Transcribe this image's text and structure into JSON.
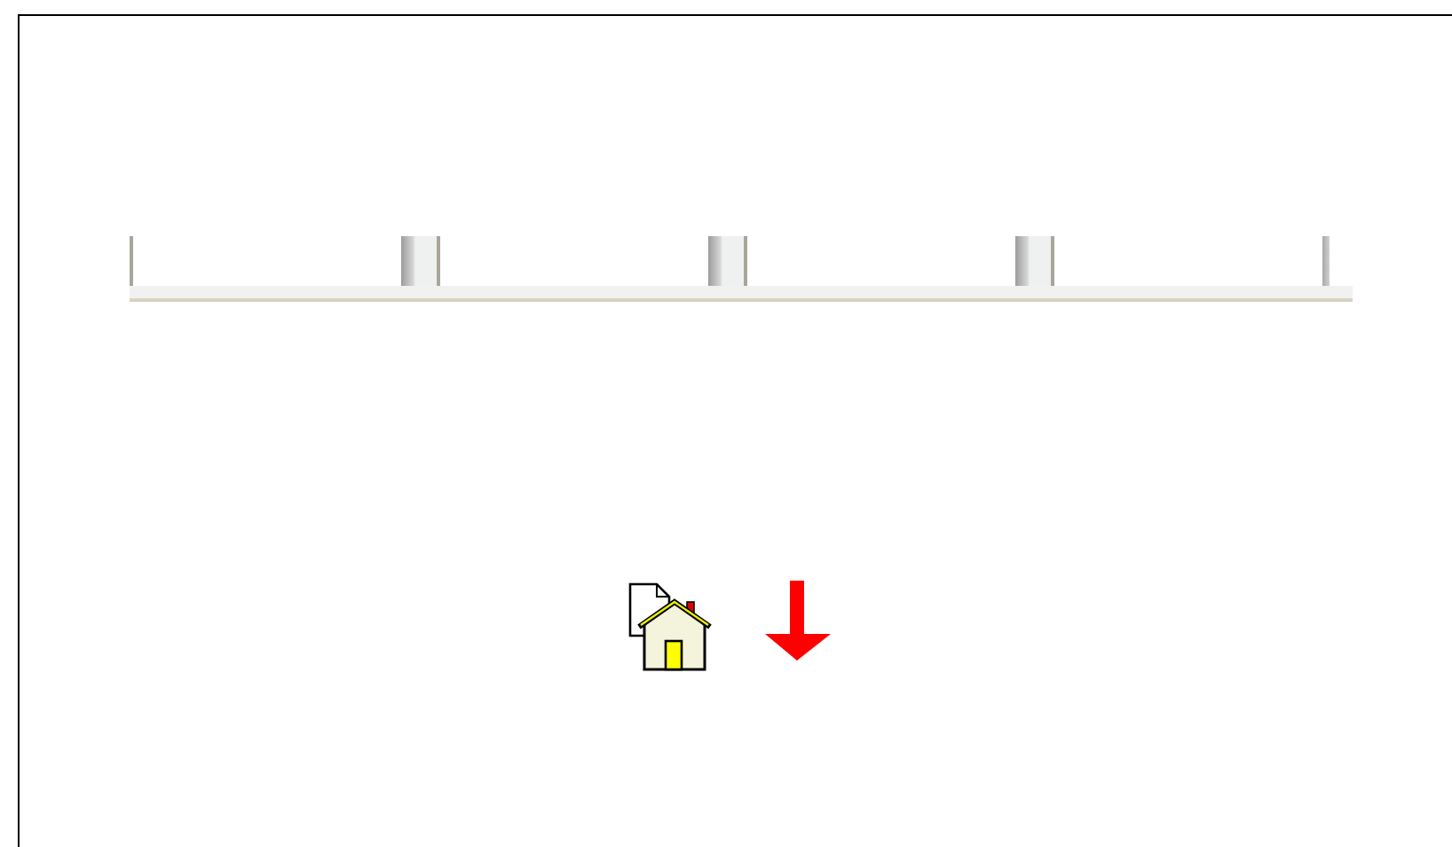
{
  "tabs": [
    {
      "kind": "blank"
    },
    {
      "kind": "blank"
    },
    {
      "kind": "blank"
    },
    {
      "kind": "blank"
    }
  ],
  "icons": [
    {
      "kind": "home-page"
    },
    {
      "kind": "down-arrow"
    }
  ]
}
